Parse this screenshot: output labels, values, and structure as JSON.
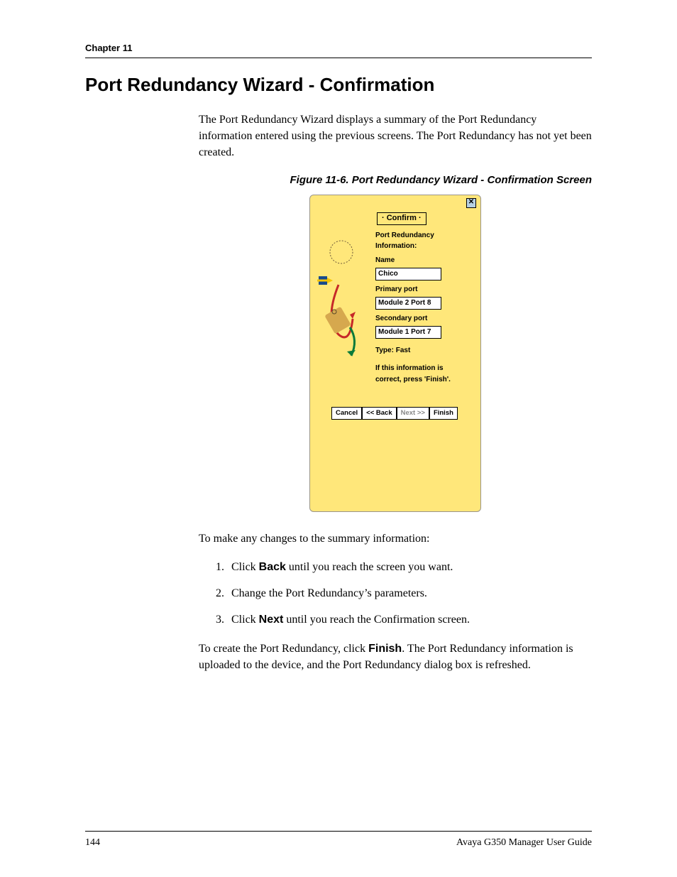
{
  "header": {
    "chapter": "Chapter 11"
  },
  "title": "Port Redundancy Wizard - Confirmation",
  "intro": "The Port Redundancy Wizard displays a summary of the Port Redundancy information entered using the previous screens. The Port Redundancy has not yet been created.",
  "figure_caption": "Figure 11-6.  Port Redundancy Wizard - Confirmation Screen",
  "wizard": {
    "step_label": "· Confirm ·",
    "close_glyph": "✕",
    "heading": "Port Redundancy Information:",
    "name_label": "Name",
    "name_value": "Chico",
    "primary_label": "Primary port",
    "primary_value": "Module 2 Port 8",
    "secondary_label": "Secondary port",
    "secondary_value": "Module 1 Port 7",
    "type_line": "Type: Fast",
    "hint1": "If this information is",
    "hint2": "correct, press 'Finish'.",
    "buttons": {
      "cancel": "Cancel",
      "back": "<< Back",
      "next": "Next >>",
      "finish": "Finish"
    }
  },
  "para_changes": "To make any changes to the summary information:",
  "steps": {
    "s1a": "Click ",
    "s1b": "Back",
    "s1c": " until you reach the screen you want.",
    "s2": "Change the Port Redundancy’s parameters.",
    "s3a": "Click ",
    "s3b": "Next",
    "s3c": " until you reach the Confirmation screen."
  },
  "para_create_a": "To create the Port Redundancy, click ",
  "para_create_b": "Finish",
  "para_create_c": ". The Port Redundancy information is uploaded to the device, and the Port Redundancy dialog box is refreshed.",
  "footer": {
    "page": "144",
    "guide": "Avaya G350 Manager User Guide"
  }
}
